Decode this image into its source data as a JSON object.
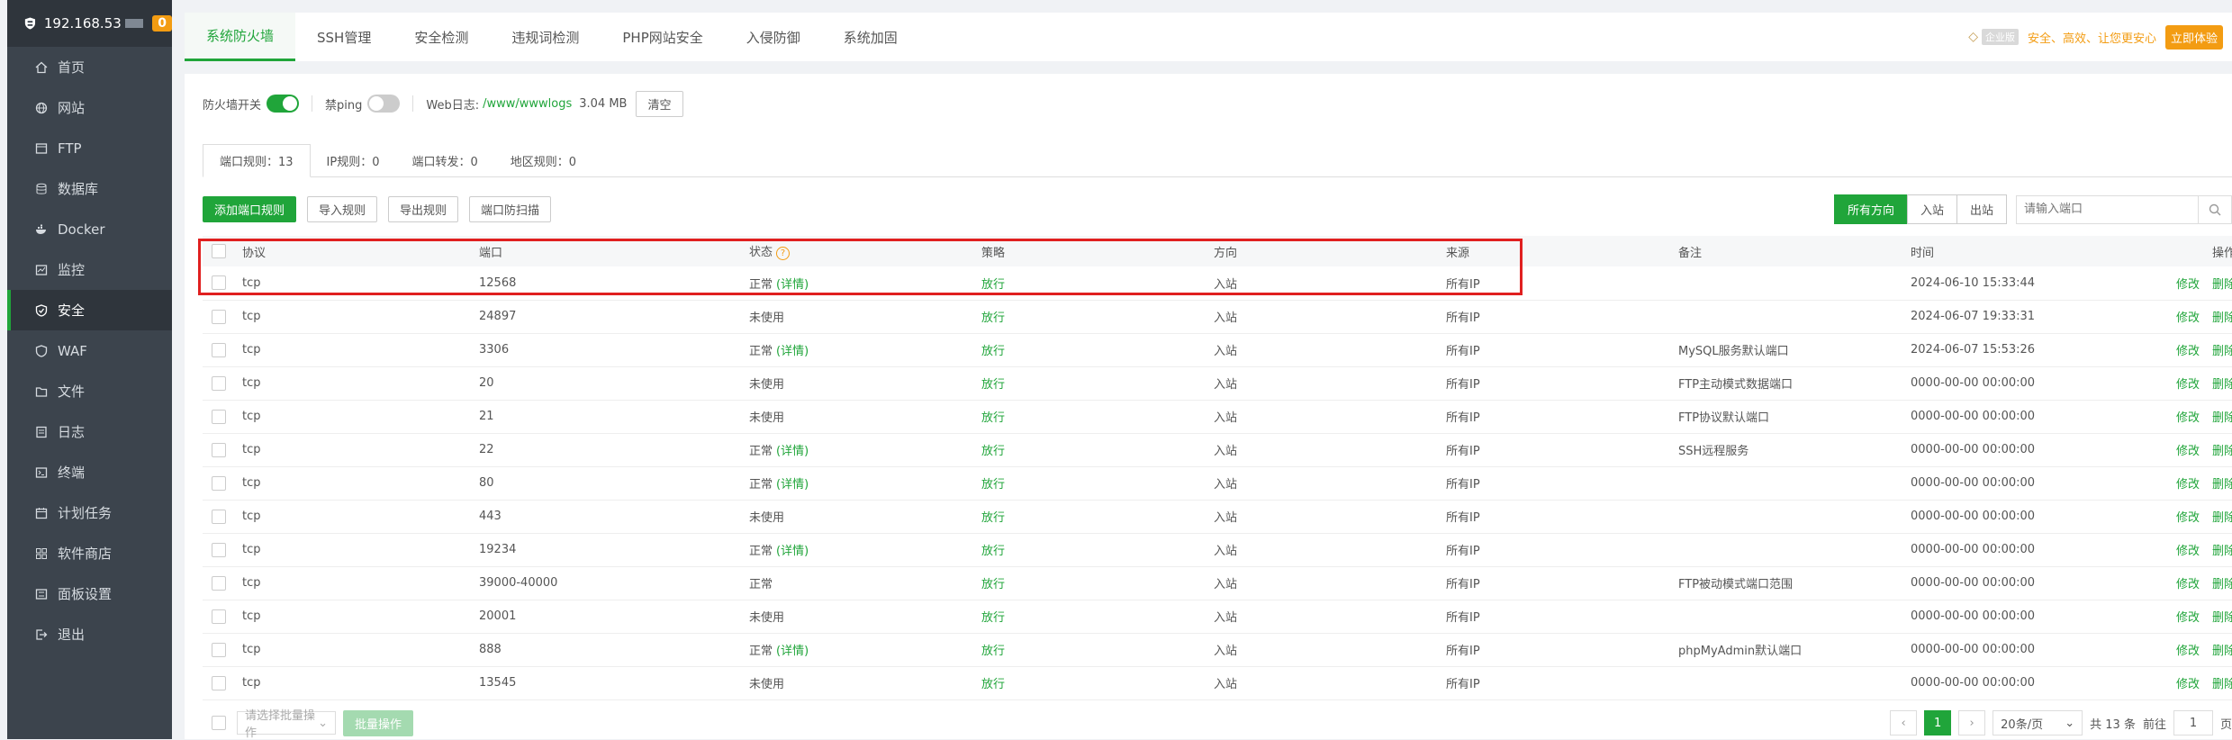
{
  "server": {
    "ip": "192.168.53",
    "badge": "0"
  },
  "sidebar": {
    "items": [
      {
        "label": "首页",
        "icon": "home-icon"
      },
      {
        "label": "网站",
        "icon": "globe-icon"
      },
      {
        "label": "FTP",
        "icon": "ftp-icon"
      },
      {
        "label": "数据库",
        "icon": "database-icon"
      },
      {
        "label": "Docker",
        "icon": "docker-icon"
      },
      {
        "label": "监控",
        "icon": "monitor-icon"
      },
      {
        "label": "安全",
        "icon": "shield-icon",
        "active": true
      },
      {
        "label": "WAF",
        "icon": "waf-icon"
      },
      {
        "label": "文件",
        "icon": "folder-icon"
      },
      {
        "label": "日志",
        "icon": "log-icon"
      },
      {
        "label": "终端",
        "icon": "terminal-icon"
      },
      {
        "label": "计划任务",
        "icon": "clock-icon"
      },
      {
        "label": "软件商店",
        "icon": "store-icon"
      },
      {
        "label": "面板设置",
        "icon": "settings-icon"
      },
      {
        "label": "退出",
        "icon": "logout-icon"
      }
    ]
  },
  "tabs": [
    "系统防火墙",
    "SSH管理",
    "安全检测",
    "违规词检测",
    "PHP网站安全",
    "入侵防御",
    "系统加固"
  ],
  "promo": {
    "edition": "企业版",
    "slogan": "安全、高效、让您更安心",
    "cta": "立即体验"
  },
  "firewall": {
    "switch_label": "防火墙开关",
    "ping_label": "禁ping",
    "weblog_label": "Web日志:",
    "weblog_path": "/www/wwwlogs",
    "weblog_size": "3.04 MB",
    "clear_label": "清空"
  },
  "subtabs": [
    "端口规则：13",
    "IP规则：0",
    "端口转发：0",
    "地区规则：0"
  ],
  "actions": [
    "添加端口规则",
    "导入规则",
    "导出规则",
    "端口防扫描"
  ],
  "direction_filter": [
    "所有方向",
    "入站",
    "出站"
  ],
  "search": {
    "placeholder": "请输入端口"
  },
  "table": {
    "columns": [
      "协议",
      "端口",
      "状态",
      "策略",
      "方向",
      "来源",
      "备注",
      "时间",
      "操作"
    ],
    "rows": [
      {
        "proto": "tcp",
        "port": "12568",
        "status": "正常",
        "detail": "(详情)",
        "policy": "放行",
        "dir": "入站",
        "source": "所有IP",
        "note": "",
        "time": "2024-06-10 15:33:44"
      },
      {
        "proto": "tcp",
        "port": "24897",
        "status": "未使用",
        "detail": "",
        "policy": "放行",
        "dir": "入站",
        "source": "所有IP",
        "note": "",
        "time": "2024-06-07 19:33:31"
      },
      {
        "proto": "tcp",
        "port": "3306",
        "status": "正常",
        "detail": "(详情)",
        "policy": "放行",
        "dir": "入站",
        "source": "所有IP",
        "note": "MySQL服务默认端口",
        "time": "2024-06-07 15:53:26"
      },
      {
        "proto": "tcp",
        "port": "20",
        "status": "未使用",
        "detail": "",
        "policy": "放行",
        "dir": "入站",
        "source": "所有IP",
        "note": "FTP主动模式数据端口",
        "time": "0000-00-00 00:00:00"
      },
      {
        "proto": "tcp",
        "port": "21",
        "status": "未使用",
        "detail": "",
        "policy": "放行",
        "dir": "入站",
        "source": "所有IP",
        "note": "FTP协议默认端口",
        "time": "0000-00-00 00:00:00"
      },
      {
        "proto": "tcp",
        "port": "22",
        "status": "正常",
        "detail": "(详情)",
        "policy": "放行",
        "dir": "入站",
        "source": "所有IP",
        "note": "SSH远程服务",
        "time": "0000-00-00 00:00:00"
      },
      {
        "proto": "tcp",
        "port": "80",
        "status": "正常",
        "detail": "(详情)",
        "policy": "放行",
        "dir": "入站",
        "source": "所有IP",
        "note": "",
        "time": "0000-00-00 00:00:00"
      },
      {
        "proto": "tcp",
        "port": "443",
        "status": "未使用",
        "detail": "",
        "policy": "放行",
        "dir": "入站",
        "source": "所有IP",
        "note": "",
        "time": "0000-00-00 00:00:00"
      },
      {
        "proto": "tcp",
        "port": "19234",
        "status": "正常",
        "detail": "(详情)",
        "policy": "放行",
        "dir": "入站",
        "source": "所有IP",
        "note": "",
        "time": "0000-00-00 00:00:00"
      },
      {
        "proto": "tcp",
        "port": "39000-40000",
        "status": "正常",
        "detail": "",
        "policy": "放行",
        "dir": "入站",
        "source": "所有IP",
        "note": "FTP被动模式端口范围",
        "time": "0000-00-00 00:00:00"
      },
      {
        "proto": "tcp",
        "port": "20001",
        "status": "未使用",
        "detail": "",
        "policy": "放行",
        "dir": "入站",
        "source": "所有IP",
        "note": "",
        "time": "0000-00-00 00:00:00"
      },
      {
        "proto": "tcp",
        "port": "888",
        "status": "正常",
        "detail": "(详情)",
        "policy": "放行",
        "dir": "入站",
        "source": "所有IP",
        "note": "phpMyAdmin默认端口",
        "time": "0000-00-00 00:00:00"
      },
      {
        "proto": "tcp",
        "port": "13545",
        "status": "未使用",
        "detail": "",
        "policy": "放行",
        "dir": "入站",
        "source": "所有IP",
        "note": "",
        "time": "0000-00-00 00:00:00"
      }
    ],
    "op_edit": "修改",
    "op_delete": "删除"
  },
  "footer": {
    "batch_placeholder": "请选择批量操作",
    "batch_button": "批量操作",
    "current_page": "1",
    "page_size": "20条/页",
    "total": "共 13 条",
    "goto_label": "前往",
    "goto_value": "1",
    "page_unit": "页"
  }
}
